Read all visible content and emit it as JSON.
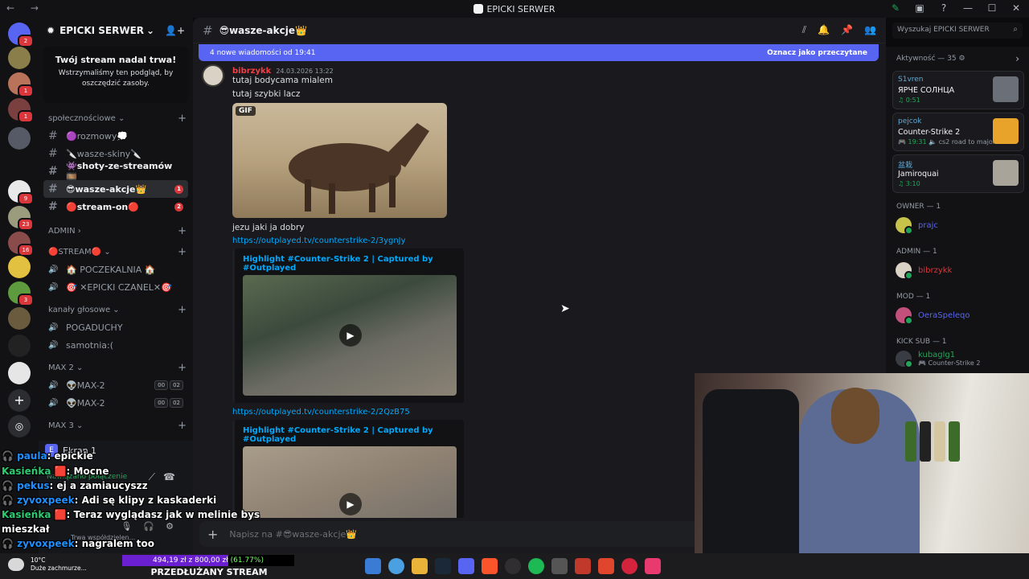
{
  "window": {
    "title": "EPICKI SERWER",
    "nav": "← →",
    "controls": [
      "—",
      "☐",
      "✕"
    ]
  },
  "rail": {
    "badges": [
      "2",
      "1",
      "1",
      "9",
      "23",
      "16",
      "3"
    ]
  },
  "sidebar": {
    "server_name": "EPICKI SERWER",
    "stream_card": {
      "title": "Twój stream nadal trwa!",
      "body": "Wstrzymaliśmy ten podgląd, by oszczędzić zasoby."
    },
    "categories": {
      "social": "społecznościowe",
      "admin": "ADMIN",
      "stream": "🔴STREAM🔴",
      "voice": "kanały głosowe",
      "max2": "MAX 2",
      "max3": "MAX 3"
    },
    "text_channels": [
      {
        "label": "🟣rozmowy💭",
        "bright": false,
        "badge": ""
      },
      {
        "label": "🔪wasze-skiny🔪",
        "bright": false,
        "badge": ""
      },
      {
        "label": "👾shoty-ze-streamów🎞️",
        "bright": true,
        "badge": ""
      },
      {
        "label": "😎wasze-akcje👑",
        "bright": true,
        "active": true,
        "badge": "1"
      },
      {
        "label": "🔴stream-on🔴",
        "bright": true,
        "badge": "2"
      }
    ],
    "stream_voice": [
      {
        "label": "🏠 POCZEKALNIA 🏠"
      },
      {
        "label": "🎯 ✕EPICKI CZANEL✕🎯"
      }
    ],
    "voice_channels": [
      {
        "label": "POGADUCHY"
      },
      {
        "label": "samotnia:("
      }
    ],
    "max2_channels": [
      {
        "label": "👽MAX-2",
        "counts": [
          "00",
          "02"
        ]
      },
      {
        "label": "👽MAX-2",
        "counts": [
          "00",
          "02"
        ]
      }
    ],
    "user_panel": {
      "screen_label": "Ekran 1",
      "connection": "Nawiązano połączenie",
      "status": "Trwa współdzielen..."
    }
  },
  "chat": {
    "channel": "😎wasze-akcje👑",
    "new_messages": "4 nowe wiadomości od 19:41",
    "mark_read": "Oznacz jako przeczytane",
    "author": "bibrzykk",
    "timestamp": "24.03.2026 13:22",
    "lines": [
      "tutaj bodycama mialem",
      "tutaj szybki lacz"
    ],
    "gif_tag": "GIF",
    "after_gif": "jezu jaki ja dobry",
    "link1": "https://outplayed.tv/counterstrike-2/3ygnJy",
    "embed1_title": "Highlight #Counter-Strike 2 | Captured by #Outplayed",
    "link2": "https://outplayed.tv/counterstrike-2/2QzB75",
    "embed2_title": "Highlight #Counter-Strike 2 | Captured by #Outplayed",
    "composer_placeholder": "Napisz na #😎wasze-akcje👑"
  },
  "search": {
    "placeholder": "Wyszukaj EPICKI SERWER"
  },
  "members": {
    "activity_header": "Aktywność — 35 ⚙",
    "activities": [
      {
        "user": "S1vren",
        "title": "ЯРЧЕ СОЛНЦА",
        "detail": "♫ 0:51",
        "sub": ""
      },
      {
        "user": "pejcok",
        "title": "Counter-Strike 2",
        "detail": "🎮 19:31",
        "sub": "🔈 cs2 road to major..."
      },
      {
        "user": "盆栽",
        "title": "Jamiroquai",
        "detail": "♫ 3:10",
        "sub": ""
      }
    ],
    "roles": [
      {
        "name": "OWNER — 1",
        "member": "prajc",
        "color": "#5865f2"
      },
      {
        "name": "ADMIN — 1",
        "member": "bibrzykk",
        "color": "#da373c"
      },
      {
        "name": "MOD — 1",
        "member": "OeraSpeleqo",
        "color": "#5865f2"
      },
      {
        "name": "KICK SUB — 1",
        "member": "kubaglg1",
        "color": "#23a559",
        "sub": "🎮 Counter-Strike 2"
      }
    ]
  },
  "overlay": {
    "messages": [
      {
        "user": "🎧 paula",
        "text": ": epickie",
        "cls": "n1"
      },
      {
        "user": "Kasieńka 🟥",
        "text": ": Mocne",
        "cls": "n2"
      },
      {
        "user": "🎧 pekus",
        "text": ": ej a zamiaucyszz",
        "cls": "n1"
      },
      {
        "user": "🎧 zyvoxpeek",
        "text": ": Adi sę klipy z kaskaderki",
        "cls": "n1"
      },
      {
        "user": "Kasieńka 🟥",
        "text": ": Teraz wyglądasz jak w melinie bys",
        "cls": "n2"
      },
      {
        "user": "",
        "text": "mieszkał",
        "cls": ""
      },
      {
        "user": "🎧 zyvoxpeek",
        "text": ": nagralem too",
        "cls": "n1"
      }
    ]
  },
  "taskbar": {
    "weather_temp": "10°C",
    "weather_desc": "Duże zachmurze...",
    "subgoal": "494,19 zł z 800,00 zł",
    "subgoal_pct": "(61.77%)",
    "subgoal_fraction": 0.6177,
    "extended": "PRZEDŁUŻANY STREAM",
    "icons": [
      "windows-icon",
      "files-icon",
      "chrome-icon",
      "explorer-icon",
      "steam-icon",
      "discord-icon",
      "brave-icon",
      "obs-icon",
      "spotify-icon",
      "app-icon",
      "app2-icon",
      "app3-icon",
      "app4-icon",
      "tiktok-icon"
    ]
  }
}
